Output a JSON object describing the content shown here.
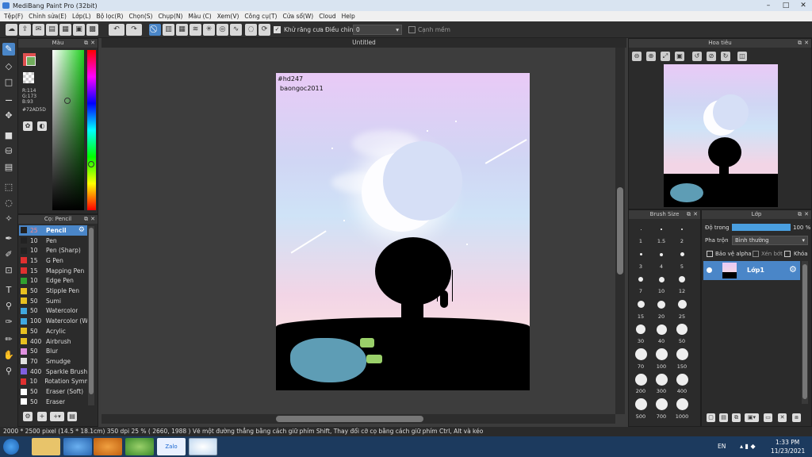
{
  "window": {
    "title": "MediBang Paint Pro (32bit)"
  },
  "menu": [
    "Tệp(F)",
    "Chỉnh sửa(E)",
    "Lớp(L)",
    "Bộ lọc(R)",
    "Chọn(S)",
    "Chụp(N)",
    "Màu (C)",
    "Xem(V)",
    "Công cụ(T)",
    "Cửa sổ(W)",
    "Cloud",
    "Help"
  ],
  "toolbar": {
    "antialias_label": "Khử răng cưa",
    "adjust_label": "Điều chỉnh",
    "adjust_value": "0",
    "soft_edge_label": "Cạnh mềm"
  },
  "color_panel": {
    "title": "Màu",
    "r": "R:114",
    "g": "G:173",
    "b": "B:93",
    "hex": "#72AD5D",
    "fg_color": "#72ad5d",
    "bg_color": "#e05050"
  },
  "brush_panel": {
    "title": "Cọ: Pencil",
    "items": [
      {
        "size": "25",
        "name": "Pencil",
        "color": "#222222",
        "selected": true
      },
      {
        "size": "10",
        "name": "Pen",
        "color": "#222222"
      },
      {
        "size": "10",
        "name": "Pen (Sharp)",
        "color": "#222222"
      },
      {
        "size": "15",
        "name": "G Pen",
        "color": "#e03030"
      },
      {
        "size": "15",
        "name": "Mapping Pen",
        "color": "#e03030"
      },
      {
        "size": "10",
        "name": "Edge Pen",
        "color": "#30a030"
      },
      {
        "size": "50",
        "name": "Stipple Pen",
        "color": "#e8c020"
      },
      {
        "size": "50",
        "name": "Sumi",
        "color": "#e8c020"
      },
      {
        "size": "50",
        "name": "Watercolor",
        "color": "#40a8e0"
      },
      {
        "size": "100",
        "name": "Watercolor (W",
        "color": "#40a8e0"
      },
      {
        "size": "50",
        "name": "Acrylic",
        "color": "#e8c020"
      },
      {
        "size": "400",
        "name": "Airbrush",
        "color": "#e8c020"
      },
      {
        "size": "50",
        "name": "Blur",
        "color": "#e090e0"
      },
      {
        "size": "70",
        "name": "Smudge",
        "color": "#e0e0e0"
      },
      {
        "size": "400",
        "name": "Sparkle Brush",
        "color": "#8060e0"
      },
      {
        "size": "10",
        "name": "Rotation Symm",
        "color": "#e03030"
      },
      {
        "size": "50",
        "name": "Eraser (Soft)",
        "color": "#ffffff"
      },
      {
        "size": "50",
        "name": "Eraser",
        "color": "#ffffff"
      }
    ]
  },
  "document": {
    "tab_title": "Untitled",
    "caption_line1": "#hd247",
    "caption_line2": "baongoc2011"
  },
  "navigator": {
    "title": "Hoa tiêu"
  },
  "brush_size_panel": {
    "title": "Brush Size",
    "sizes": [
      "1",
      "1.5",
      "2",
      "3",
      "4",
      "5",
      "7",
      "10",
      "12",
      "15",
      "20",
      "25",
      "30",
      "40",
      "50",
      "70",
      "100",
      "150",
      "200",
      "300",
      "400",
      "500",
      "700",
      "1000"
    ]
  },
  "layer_panel": {
    "title": "Lớp",
    "opacity_label": "Độ trong",
    "opacity_value": "100 %",
    "opacity_fraction": 1.0,
    "blend_label": "Pha trộn",
    "blend_value": "Bình thường",
    "protect_alpha": "Bảo vệ alpha",
    "clipping": "Xén bớt",
    "lock": "Khóa",
    "layer_name": "Lớp1"
  },
  "status": {
    "text": "2000 * 2500 pixel    (14.5 * 18.1cm)   350 dpi   25 %   ( 2660, 1988 )   Vẽ một đường thẳng bằng cách giữ phím Shift, Thay đổi cỡ cọ bằng cách giữ phím Ctrl, Alt và kéo"
  },
  "taskbar": {
    "lang": "EN",
    "time": "1:33 PM",
    "date": "11/23/2021",
    "zalo_label": "Zalo"
  }
}
